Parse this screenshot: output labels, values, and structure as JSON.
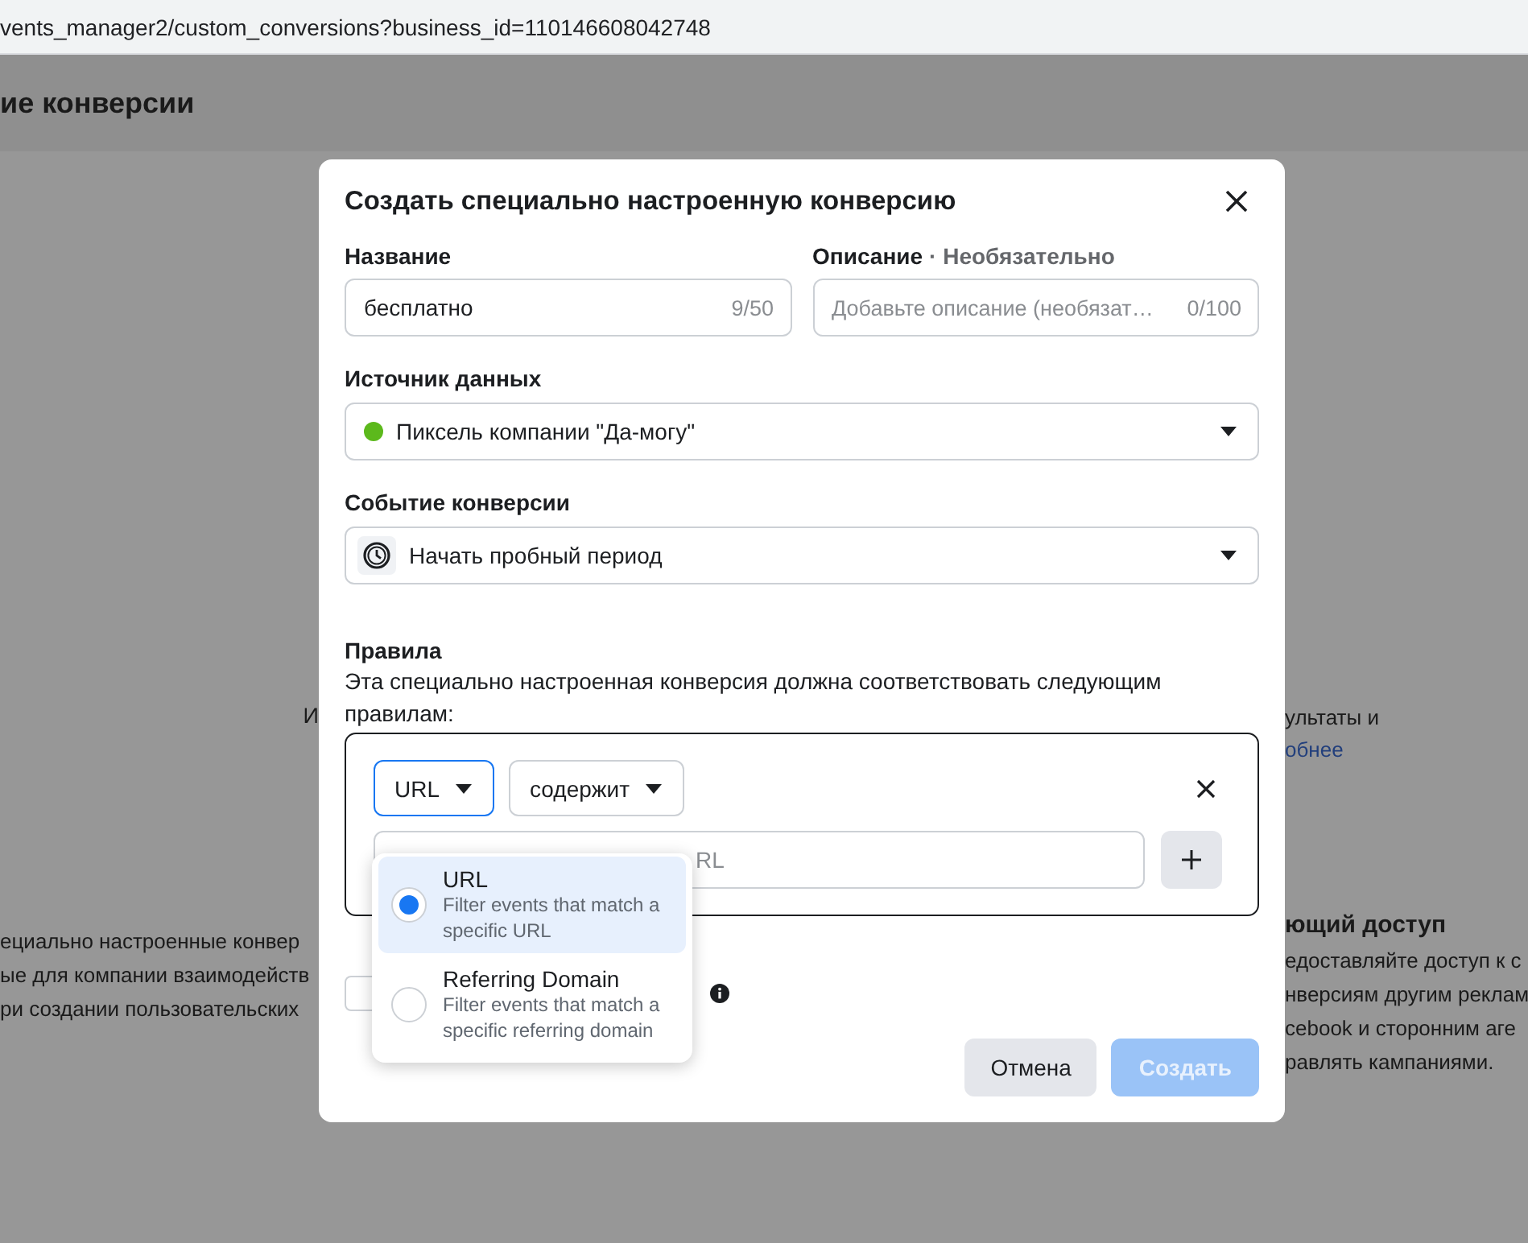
{
  "address_bar": {
    "url": "vents_manager2/custom_conversions?business_id=110146608042748"
  },
  "background": {
    "title": "ие конверсии",
    "left": {
      "fragment": "И",
      "paragraph_lines": [
        "ециально настроенные конвер",
        "ые для компании взаимодейств",
        "ри создании пользовательских"
      ]
    },
    "right": {
      "fragment": "ультаты и",
      "link": "обнее",
      "heading": "ющий доступ",
      "paragraph_lines": [
        "едоставляйте доступ к с",
        "нверсиям другим реклам",
        "cebook и сторонним аге",
        "равлять кампаниями."
      ]
    }
  },
  "dialog": {
    "title": "Создать специально настроенную конверсию",
    "name_field": {
      "label": "Название",
      "value": "бесплатно",
      "counter": "9/50"
    },
    "description_field": {
      "label": "Описание",
      "hint": "· Необязательно",
      "placeholder": "Добавьте описание (необязат…",
      "counter": "0/100"
    },
    "data_source": {
      "label": "Источник данных",
      "value": "Пиксель компании \"Да-могу\""
    },
    "conversion_event": {
      "label": "Событие конверсии",
      "value": "Начать пробный период"
    },
    "rules": {
      "title": "Правила",
      "description": "Эта специально настроенная конверсия должна соответствовать следующим правилам:",
      "field_select": {
        "value": "URL",
        "focused": true
      },
      "operator_select": {
        "value": "содержит",
        "focused": false
      },
      "value_input": {
        "placeholder": "RL"
      }
    },
    "checkbox": {
      "checked": false
    },
    "menu": {
      "options": [
        {
          "label": "URL",
          "description": "Filter events that match a specific URL",
          "selected": true
        },
        {
          "label": "Referring Domain",
          "description": "Filter events that match a specific referring domain",
          "selected": false
        }
      ]
    },
    "buttons": [
      {
        "label": "Отмена",
        "kind": "secondary",
        "disabled": false
      },
      {
        "label": "Создать",
        "kind": "primary",
        "disabled": true
      }
    ]
  }
}
